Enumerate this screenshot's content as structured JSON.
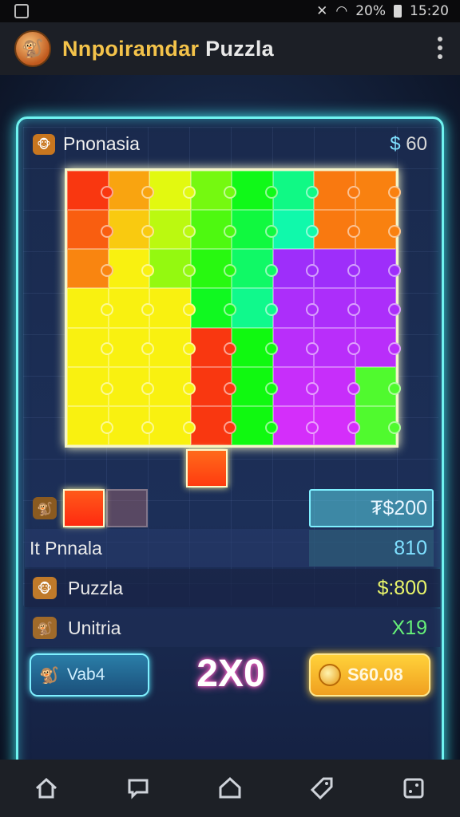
{
  "status": {
    "battery": "20%",
    "time": "15:20"
  },
  "app": {
    "title_highlight": "Nnpoiramdar",
    "title_rest": "Puzzla"
  },
  "board": {
    "title": "Pnonasia",
    "score_prefix": "$",
    "score_value": "60"
  },
  "rows": [
    {
      "label": "",
      "value": "₮$200",
      "value_color": "#e8f6ff"
    },
    {
      "label": "It Pnnala",
      "value": "810",
      "value_color": "#7fe0ff"
    },
    {
      "label": "Puzzla",
      "value": "$:800",
      "value_color": "#e9f56a"
    },
    {
      "label": "Unitria",
      "value": "X19",
      "value_color": "#66f078"
    }
  ],
  "bottom": {
    "left_label": "Vab4",
    "center": "2X0",
    "right_label": "S60.08"
  },
  "colors": {
    "frame": "#6ff3f0",
    "accent_gold": "#f4c34a",
    "center_pink": "#ff7fd0"
  },
  "icons": [
    "home-icon",
    "chat-icon",
    "house-icon",
    "tag-icon",
    "dice-icon"
  ]
}
